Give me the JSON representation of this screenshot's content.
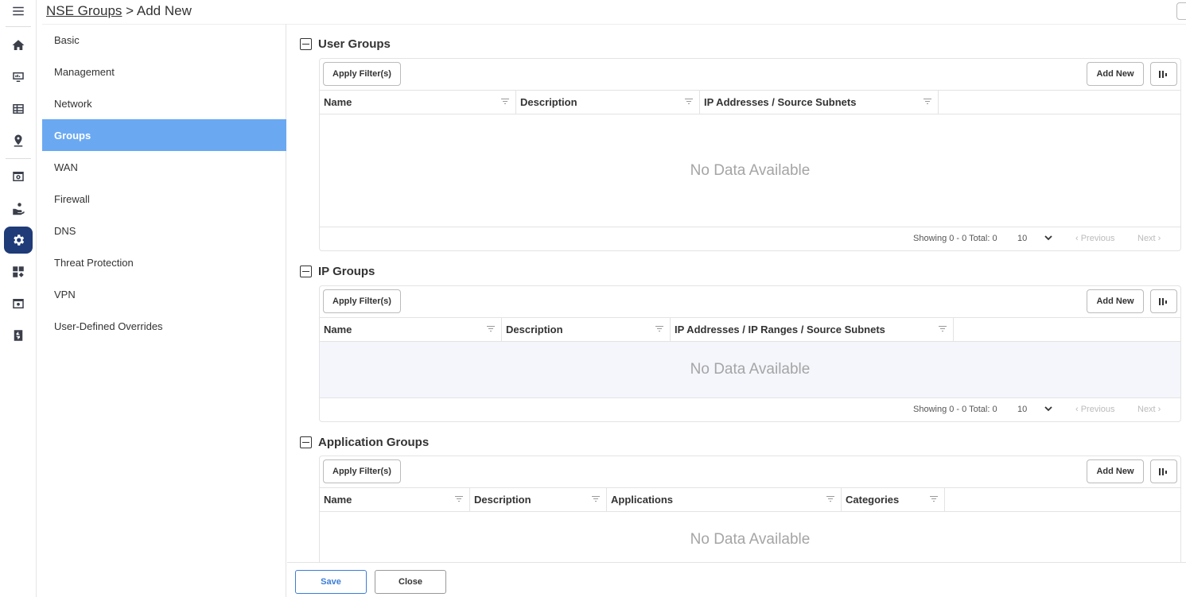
{
  "header": {
    "breadcrumb_link": "NSE Groups",
    "breadcrumb_separator": " > ",
    "breadcrumb_current": "Add New"
  },
  "rail": {
    "icons": [
      "menu-icon",
      "home-icon",
      "monitor-icon",
      "table-icon",
      "location-icon",
      "dashboard-icon",
      "hand-coin-icon",
      "gear-icon",
      "widgets-icon",
      "window-settings-icon",
      "dollar-icon"
    ],
    "active": "gear-icon"
  },
  "subnav": {
    "items": [
      {
        "label": "Basic"
      },
      {
        "label": "Management"
      },
      {
        "label": "Network"
      },
      {
        "label": "Groups"
      },
      {
        "label": "WAN"
      },
      {
        "label": "Firewall"
      },
      {
        "label": "DNS"
      },
      {
        "label": "Threat Protection"
      },
      {
        "label": "VPN"
      },
      {
        "label": "User-Defined Overrides"
      }
    ],
    "active": "Groups",
    "active_color": "#6aa9f2"
  },
  "sections": {
    "user_groups": {
      "title": "User Groups",
      "apply_filter": "Apply Filter(s)",
      "add_new": "Add New",
      "columns": [
        "Name",
        "Description",
        "IP Addresses / Source Subnets"
      ],
      "no_data": "No Data Available",
      "showing": "Showing 0 - 0 Total: 0",
      "page_size": "10",
      "previous": "‹ Previous",
      "next": "Next ›"
    },
    "ip_groups": {
      "title": "IP Groups",
      "apply_filter": "Apply Filter(s)",
      "add_new": "Add New",
      "columns": [
        "Name",
        "Description",
        "IP Addresses / IP Ranges / Source Subnets"
      ],
      "no_data": "No Data Available",
      "showing": "Showing 0 - 0 Total: 0",
      "page_size": "10",
      "previous": "‹ Previous",
      "next": "Next ›"
    },
    "application_groups": {
      "title": "Application Groups",
      "apply_filter": "Apply Filter(s)",
      "add_new": "Add New",
      "columns": [
        "Name",
        "Description",
        "Applications",
        "Categories"
      ],
      "no_data": "No Data Available"
    }
  },
  "actions": {
    "save": "Save",
    "close": "Close"
  },
  "colors": {
    "accent": "#1f3b78",
    "save_border": "#3b7dd8"
  }
}
